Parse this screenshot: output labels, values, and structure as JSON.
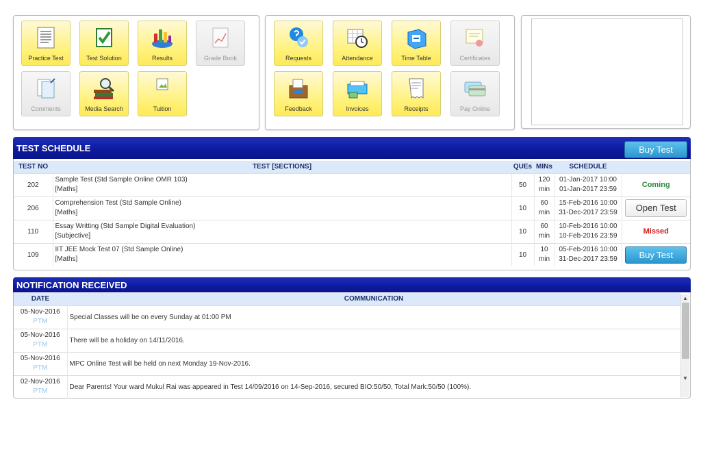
{
  "tiles_left": [
    {
      "label": "Practice Test",
      "icon": "practice-test-icon",
      "enabled": true
    },
    {
      "label": "Test Solution",
      "icon": "test-solution-icon",
      "enabled": true
    },
    {
      "label": "Results",
      "icon": "results-icon",
      "enabled": true
    },
    {
      "label": "Grade Book",
      "icon": "grade-book-icon",
      "enabled": false
    },
    {
      "label": "Comments",
      "icon": "comments-icon",
      "enabled": false
    },
    {
      "label": "Media Search",
      "icon": "media-search-icon",
      "enabled": true
    },
    {
      "label": "Tuition",
      "icon": "tuition-icon",
      "enabled": true
    }
  ],
  "tiles_mid": [
    {
      "label": "Requests",
      "icon": "requests-icon",
      "enabled": true
    },
    {
      "label": "Attendance",
      "icon": "attendance-icon",
      "enabled": true
    },
    {
      "label": "Time Table",
      "icon": "time-table-icon",
      "enabled": true
    },
    {
      "label": "Certificates",
      "icon": "certificates-icon",
      "enabled": false
    },
    {
      "label": "Feedback",
      "icon": "feedback-icon",
      "enabled": true
    },
    {
      "label": "Invoices",
      "icon": "invoices-icon",
      "enabled": true
    },
    {
      "label": "Receipts",
      "icon": "receipts-icon",
      "enabled": true
    },
    {
      "label": "Pay Online",
      "icon": "pay-online-icon",
      "enabled": false
    }
  ],
  "test_schedule": {
    "title": "TEST SCHEDULE",
    "buy_label": "Buy Test",
    "headers": {
      "test_no": "TEST NO",
      "sections": "TEST [SECTIONS]",
      "ques": "QUEs",
      "mins": "MINs",
      "schedule": "SCHEDULE"
    },
    "rows": [
      {
        "no": "202",
        "name": "Sample Test (Std Sample Online OMR 103)",
        "section": "[Maths]",
        "ques": "50",
        "mins": "120",
        "unit": "min",
        "start": "01-Jan-2017 10:00",
        "end": "01-Jan-2017 23:59",
        "status": "Coming",
        "kind": "coming"
      },
      {
        "no": "206",
        "name": "Comprehension Test (Std Sample Online)",
        "section": "[Maths]",
        "ques": "10",
        "mins": "60",
        "unit": "min",
        "start": "15-Feb-2016 10:00",
        "end": "31-Dec-2017 23:59",
        "status": "Open Test",
        "kind": "open"
      },
      {
        "no": "110",
        "name": "Essay Writting (Std Sample Digital Evaluation)",
        "section": "[Subjective]",
        "ques": "10",
        "mins": "60",
        "unit": "min",
        "start": "10-Feb-2016 10:00",
        "end": "10-Feb-2016 23:59",
        "status": "Missed",
        "kind": "missed"
      },
      {
        "no": "109",
        "name": "IIT JEE Mock Test 07 (Std Sample Online)",
        "section": "[Maths]",
        "ques": "10",
        "mins": "10",
        "unit": "min",
        "start": "05-Feb-2016 10:00",
        "end": "31-Dec-2017 23:59",
        "status": "Buy Test",
        "kind": "buy"
      }
    ]
  },
  "notifications": {
    "title": "NOTIFICATION RECEIVED",
    "headers": {
      "date": "DATE",
      "communication": "COMMUNICATION"
    },
    "rows": [
      {
        "date": "05-Nov-2016",
        "tag": "PTM",
        "text": "Special Classes will be on every Sunday at 01:00 PM"
      },
      {
        "date": "05-Nov-2016",
        "tag": "PTM",
        "text": "There will be a holiday on 14/11/2016."
      },
      {
        "date": "05-Nov-2016",
        "tag": "PTM",
        "text": "MPC Online Test will be held on next Monday 19-Nov-2016."
      },
      {
        "date": "02-Nov-2016",
        "tag": "PTM",
        "text": "Dear Parents! Your ward Mukul Rai was appeared in Test 14/09/2016 on 14-Sep-2016, secured BIO:50/50, Total Mark:50/50 (100%)."
      }
    ]
  }
}
